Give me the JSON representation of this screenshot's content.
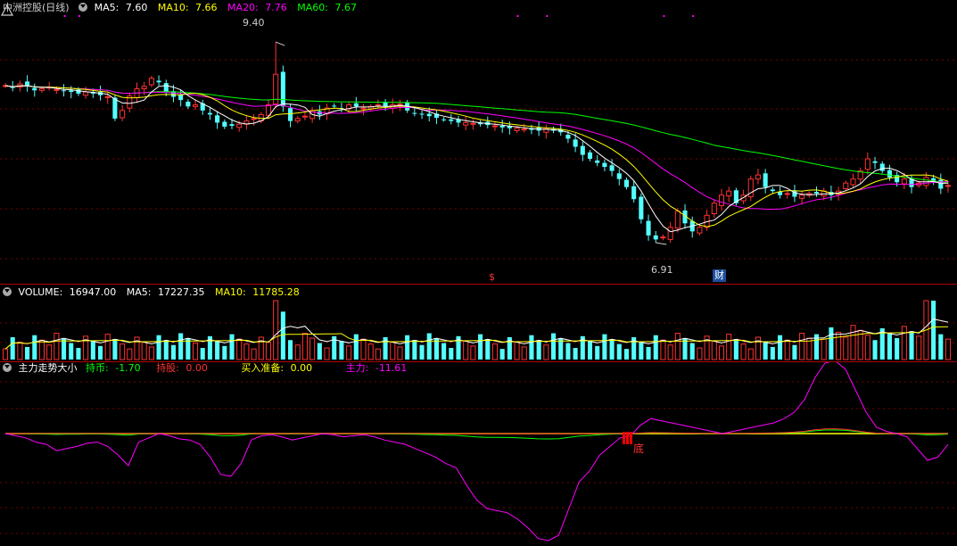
{
  "price_panel": {
    "title": "中洲控股(日线)",
    "ma5_label": "MA5:",
    "ma5": "7.60",
    "ma10_label": "MA10:",
    "ma10": "7.66",
    "ma20_label": "MA20:",
    "ma20": "7.76",
    "ma60_label": "MA60:",
    "ma60": "7.67",
    "high_label": "9.40",
    "low_label": "6.91",
    "marker_dollar": "$",
    "marker_cai": "财",
    "colors": {
      "ma5": "#ffffff",
      "ma10": "#ffff00",
      "ma20": "#ff00ff",
      "ma60": "#00ff00",
      "up": "#ff3232",
      "down": "#54ffff"
    }
  },
  "volume_panel": {
    "title": "VOLUME:",
    "volume": "16947.00",
    "ma5_label": "MA5:",
    "ma5": "17227.35",
    "ma10_label": "MA10:",
    "ma10": "11785.28"
  },
  "indicator_panel": {
    "title": "主力走势大小",
    "hold_cash_label": "持币:",
    "hold_cash": "-1.70",
    "hold_stock_label": "持股:",
    "hold_stock": "0.00",
    "buy_prep_label": "买入准备:",
    "buy_prep": "0.00",
    "main_force_label": "主力:",
    "main_force": "-11.61",
    "bottom_label": "底"
  },
  "chart_data": [
    {
      "type": "candlestick",
      "title": "中洲控股(日线)",
      "ylim": [
        6.6,
        9.7
      ],
      "annotations": {
        "high": 9.4,
        "low": 6.91
      },
      "series": [
        {
          "name": "MA5",
          "last": 7.6
        },
        {
          "name": "MA10",
          "last": 7.66
        },
        {
          "name": "MA20",
          "last": 7.76
        },
        {
          "name": "MA60",
          "last": 7.67
        }
      ],
      "close": [
        8.86,
        8.83,
        8.88,
        8.85,
        8.8,
        8.82,
        8.84,
        8.81,
        8.79,
        8.78,
        8.76,
        8.78,
        8.76,
        8.74,
        8.72,
        8.45,
        8.55,
        8.73,
        8.82,
        8.85,
        8.95,
        8.9,
        8.78,
        8.72,
        8.68,
        8.6,
        8.62,
        8.55,
        8.5,
        8.4,
        8.35,
        8.36,
        8.38,
        8.42,
        8.45,
        8.5,
        8.62,
        9.0,
        8.6,
        8.42,
        8.45,
        8.48,
        8.55,
        8.5,
        8.58,
        8.6,
        8.57,
        8.62,
        8.6,
        8.58,
        8.6,
        8.62,
        8.6,
        8.62,
        8.63,
        8.55,
        8.52,
        8.5,
        8.48,
        8.46,
        8.44,
        8.42,
        8.4,
        8.4,
        8.39,
        8.38,
        8.37,
        8.36,
        8.34,
        8.33,
        8.33,
        8.32,
        8.31,
        8.3,
        8.32,
        8.3,
        8.28,
        8.2,
        8.1,
        8.0,
        7.95,
        7.9,
        7.85,
        7.8,
        7.7,
        7.6,
        7.45,
        7.2,
        7.0,
        6.95,
        6.98,
        7.1,
        7.3,
        7.15,
        7.05,
        7.1,
        7.25,
        7.4,
        7.5,
        7.55,
        7.4,
        7.5,
        7.7,
        7.75,
        7.6,
        7.55,
        7.5,
        7.52,
        7.48,
        7.5,
        7.52,
        7.52,
        7.55,
        7.5,
        7.55,
        7.65,
        7.7,
        7.8,
        7.95,
        7.9,
        7.8,
        7.72,
        7.66,
        7.7,
        7.6,
        7.65,
        7.72,
        7.68,
        7.58,
        7.62
      ],
      "volume": {
        "last": 16947.0,
        "ma5": 17227.35,
        "ma10": 11785.28
      }
    },
    {
      "type": "line",
      "title": "主力走势大小",
      "series": [
        {
          "name": "持币",
          "last": -1.7
        },
        {
          "name": "持股",
          "last": 0.0
        },
        {
          "name": "买入准备",
          "last": 0.0
        },
        {
          "name": "主力",
          "last": -11.61
        }
      ],
      "main_force": [
        0,
        -2,
        -4,
        -8,
        -10,
        -16,
        -14,
        -12,
        -9,
        -8,
        -12,
        -20,
        -30,
        -8,
        -4,
        0,
        -2,
        -5,
        -6,
        -10,
        -22,
        -38,
        -40,
        -28,
        -6,
        -2,
        -1,
        -3,
        -6,
        -4,
        -2,
        0,
        -1,
        -3,
        -2,
        -1,
        -3,
        -6,
        -8,
        -10,
        -14,
        -18,
        -22,
        -28,
        -32,
        -48,
        -62,
        -70,
        -72,
        -74,
        -80,
        -88,
        -98,
        -100,
        -95,
        -70,
        -45,
        -35,
        -20,
        -12,
        -4,
        -2,
        8,
        14,
        12,
        10,
        8,
        6,
        4,
        2,
        0,
        2,
        4,
        6,
        8,
        10,
        14,
        20,
        32,
        52,
        66,
        68,
        60,
        40,
        20,
        6,
        2,
        0,
        -3,
        -14,
        -25,
        -22,
        -10
      ]
    }
  ]
}
